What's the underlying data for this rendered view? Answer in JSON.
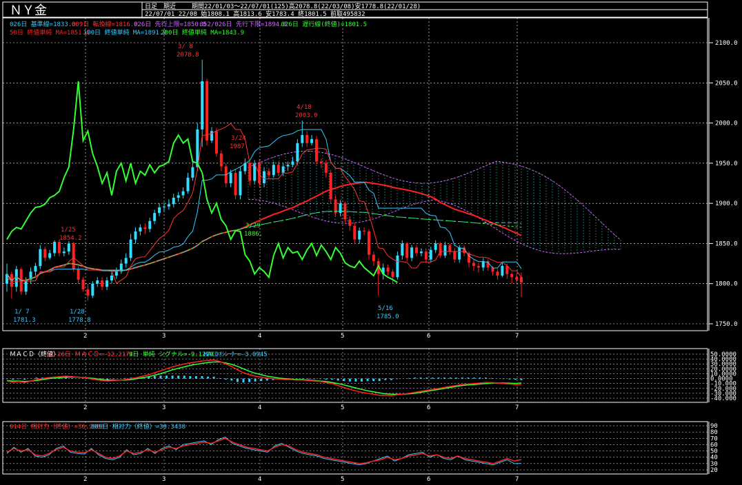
{
  "header": {
    "title": "ＮＹ金",
    "mode": "日足　期近",
    "line1": "期間22/01/03～22/07/01(125)高2078.8(22/03/08)安1778.8(22/01/28)",
    "line2": "22/07/01 22/08 始1808.1 高1813.6 安1783.4 終1801.5 前取495832"
  },
  "legend": {
    "row1": [
      {
        "text": "026日 基準線=1833.0",
        "color": "#33ccff"
      },
      {
        "text": "009日 転換線=1816.9",
        "color": "#ff3333"
      },
      {
        "text": "026日 先行上限=1850.0",
        "color": "#cc66ff"
      },
      {
        "text": "052/026日 先行下限=1894.0",
        "color": "#cc66ff"
      },
      {
        "text": "026日 遅行線(終値)=1801.5",
        "color": "#33ff33"
      }
    ],
    "row2": [
      {
        "text": "50日 終値単純 MA=1851.4",
        "color": "#ff2222"
      },
      {
        "text": "100日 終値単純 MA=1891.2",
        "color": "#33ccff"
      },
      {
        "text": "200日 終値単純 MA=1843.9",
        "color": "#33ff33"
      }
    ]
  },
  "macd_legend": [
    {
      "text": "ＭＡＣＤ（終値）",
      "color": "#ffffff"
    },
    {
      "text": "12-26日 ＭＡＣＤ=-12.2174",
      "color": "#ff3333"
    },
    {
      "text": "9日 単純 シグナル=-9.1229",
      "color": "#33ff33"
    },
    {
      "text": "MACDｵｼﾚｰﾀｰ=-3.0945",
      "color": "#33ccff"
    }
  ],
  "rsi_legend": [
    {
      "text": "014日 相対力（終値）=36.2803",
      "color": "#ff3333"
    },
    {
      "text": "009日 相対力（終値）=30.3438",
      "color": "#33ccff"
    }
  ],
  "annotations": [
    {
      "label": "3/ 8",
      "value": "2078.8",
      "color": "#ff3333"
    },
    {
      "label": "4/18",
      "value": "2003.0",
      "color": "#ff3333"
    },
    {
      "label": "3/24",
      "value": "1987.",
      "color": "#ff3333"
    },
    {
      "label": "1/25",
      "value": "1854.2",
      "color": "#ff3333"
    },
    {
      "label": "3/29",
      "value": "1886.",
      "color": "#33ff33"
    },
    {
      "label": "1/ 7",
      "value": "1781.3",
      "color": "#33ccff"
    },
    {
      "label": "1/28",
      "value": "1778.8",
      "color": "#33ccff"
    },
    {
      "label": "5/16",
      "value": "1785.0",
      "color": "#33ccff"
    }
  ],
  "chart_data": [
    {
      "type": "candlestick",
      "name": "price",
      "x_ticks": [
        "2",
        "3",
        "4",
        "5",
        "6",
        "7"
      ],
      "y_ticks": [
        1750,
        1800,
        1850,
        1900,
        1950,
        2000,
        2050,
        2100
      ],
      "y_tick_labels": [
        "1750.0",
        "1800.0",
        "1850.0",
        "1900.0",
        "1950.0",
        "2000.0",
        "2050.0",
        "2100.0"
      ],
      "ylim": [
        1740,
        2115
      ],
      "closes": [
        1812,
        1796,
        1818,
        1790,
        1805,
        1815,
        1822,
        1843,
        1832,
        1838,
        1852,
        1838,
        1840,
        1850,
        1818,
        1805,
        1793,
        1785,
        1800,
        1804,
        1796,
        1804,
        1810,
        1815,
        1825,
        1832,
        1855,
        1865,
        1870,
        1868,
        1878,
        1888,
        1895,
        1896,
        1899,
        1907,
        1910,
        1915,
        1932,
        1945,
        1992,
        2052,
        1978,
        1990,
        1962,
        1946,
        1925,
        1938,
        1910,
        1940,
        1950,
        1928,
        1950,
        1925,
        1940,
        1935,
        1948,
        1938,
        1946,
        1948,
        1952,
        1975,
        1985,
        1975,
        1980,
        1952,
        1950,
        1938,
        1905,
        1888,
        1900,
        1880,
        1872,
        1855,
        1866,
        1865,
        1836,
        1828,
        1812,
        1820,
        1815,
        1808,
        1835,
        1850,
        1832,
        1845,
        1838,
        1840,
        1830,
        1842,
        1850,
        1835,
        1848,
        1840,
        1830,
        1845,
        1838,
        1826,
        1822,
        1820,
        1828,
        1820,
        1815,
        1810,
        1822,
        1812,
        1808,
        1805,
        1801.5
      ],
      "opens": [
        1800,
        1812,
        1796,
        1818,
        1790,
        1805,
        1815,
        1822,
        1843,
        1832,
        1838,
        1852,
        1838,
        1840,
        1850,
        1818,
        1805,
        1793,
        1785,
        1800,
        1804,
        1796,
        1804,
        1810,
        1815,
        1825,
        1832,
        1855,
        1865,
        1870,
        1868,
        1878,
        1888,
        1895,
        1896,
        1899,
        1907,
        1910,
        1915,
        1932,
        1945,
        1992,
        2052,
        1978,
        1990,
        1962,
        1946,
        1925,
        1938,
        1910,
        1940,
        1950,
        1928,
        1950,
        1925,
        1940,
        1935,
        1948,
        1938,
        1946,
        1948,
        1952,
        1975,
        1985,
        1975,
        1980,
        1952,
        1950,
        1938,
        1905,
        1888,
        1900,
        1880,
        1872,
        1855,
        1866,
        1865,
        1836,
        1828,
        1812,
        1820,
        1815,
        1808,
        1835,
        1850,
        1832,
        1845,
        1838,
        1840,
        1830,
        1842,
        1850,
        1835,
        1848,
        1840,
        1830,
        1845,
        1838,
        1826,
        1822,
        1820,
        1828,
        1820,
        1815,
        1810,
        1822,
        1812,
        1808,
        1808.1
      ],
      "highs": [
        1825,
        1815,
        1822,
        1820,
        1808,
        1820,
        1826,
        1848,
        1846,
        1842,
        1854,
        1855,
        1845,
        1853,
        1852,
        1822,
        1808,
        1800,
        1803,
        1808,
        1808,
        1808,
        1814,
        1820,
        1830,
        1838,
        1862,
        1870,
        1874,
        1875,
        1882,
        1892,
        1900,
        1901,
        1905,
        1912,
        1914,
        1920,
        1938,
        1952,
        2000,
        2078.8,
        2055,
        1995,
        1994,
        1966,
        1950,
        1942,
        1942,
        1946,
        1956,
        1952,
        1954,
        1955,
        1945,
        1944,
        1952,
        1952,
        1950,
        1952,
        1958,
        1980,
        2003,
        1990,
        1985,
        1984,
        1956,
        1954,
        1942,
        1910,
        1904,
        1902,
        1884,
        1876,
        1870,
        1870,
        1868,
        1840,
        1832,
        1825,
        1824,
        1818,
        1840,
        1854,
        1852,
        1848,
        1848,
        1844,
        1844,
        1846,
        1854,
        1852,
        1852,
        1850,
        1844,
        1848,
        1848,
        1840,
        1830,
        1826,
        1832,
        1830,
        1822,
        1818,
        1826,
        1825,
        1814,
        1812,
        1813.6
      ],
      "lows": [
        1790,
        1781.3,
        1790,
        1786,
        1786,
        1800,
        1810,
        1818,
        1828,
        1830,
        1834,
        1834,
        1834,
        1836,
        1815,
        1800,
        1790,
        1778.8,
        1782,
        1796,
        1792,
        1792,
        1800,
        1806,
        1812,
        1820,
        1828,
        1850,
        1860,
        1862,
        1864,
        1874,
        1884,
        1890,
        1892,
        1895,
        1902,
        1906,
        1912,
        1928,
        1940,
        1970,
        1972,
        1975,
        1958,
        1940,
        1920,
        1920,
        1905,
        1905,
        1936,
        1922,
        1924,
        1920,
        1920,
        1930,
        1932,
        1934,
        1934,
        1940,
        1945,
        1948,
        1970,
        1970,
        1972,
        1948,
        1944,
        1932,
        1900,
        1884,
        1884,
        1876,
        1866,
        1850,
        1850,
        1860,
        1830,
        1822,
        1785,
        1805,
        1810,
        1800,
        1805,
        1830,
        1828,
        1828,
        1834,
        1834,
        1826,
        1826,
        1838,
        1832,
        1832,
        1836,
        1826,
        1826,
        1834,
        1820,
        1816,
        1814,
        1816,
        1816,
        1810,
        1805,
        1808,
        1806,
        1800,
        1800,
        1783.4
      ]
    },
    {
      "type": "line",
      "name": "MACD",
      "y_tick_labels": [
        "50.0000",
        "40.0000",
        "30.0000",
        "20.0000",
        "10.0000",
        "0.0000",
        "-10.000",
        "-20.000",
        "-30.000",
        "-40.000"
      ],
      "ylim": [
        -45,
        55
      ],
      "series": [
        {
          "name": "MACD",
          "values": [
            -5,
            -7,
            -6,
            -8,
            -5,
            -2,
            0,
            2,
            3,
            4,
            5,
            4,
            3,
            2,
            0,
            -2,
            -4,
            -5,
            -4,
            -3,
            -2,
            0,
            2,
            5,
            8,
            12,
            16,
            20,
            24,
            27,
            30,
            32,
            34,
            36,
            37,
            38,
            35,
            30,
            25,
            18,
            12,
            8,
            5,
            3,
            1,
            0,
            -1,
            -2,
            -2,
            -3,
            -3,
            -4,
            -5,
            -6,
            -8,
            -10,
            -14,
            -18,
            -22,
            -25,
            -28,
            -30,
            -32,
            -34,
            -34,
            -35,
            -33,
            -32,
            -30,
            -28,
            -26,
            -24,
            -22,
            -20,
            -18,
            -16,
            -14,
            -12,
            -11,
            -10,
            -9,
            -8,
            -8,
            -9,
            -10,
            -11,
            -12,
            -12.2174
          ]
        },
        {
          "name": "シグナル",
          "values": [
            -4,
            -5,
            -5,
            -6,
            -5,
            -4,
            -2,
            0,
            1,
            2,
            3,
            3,
            3,
            2,
            1,
            0,
            -2,
            -3,
            -3,
            -3,
            -3,
            -2,
            0,
            2,
            4,
            7,
            10,
            14,
            18,
            21,
            24,
            27,
            29,
            31,
            33,
            34,
            34,
            32,
            29,
            25,
            20,
            15,
            11,
            8,
            5,
            3,
            1,
            0,
            -1,
            -2,
            -2,
            -3,
            -4,
            -5,
            -6,
            -8,
            -10,
            -13,
            -16,
            -19,
            -22,
            -25,
            -27,
            -29,
            -31,
            -32,
            -32,
            -32,
            -31,
            -30,
            -28,
            -26,
            -24,
            -22,
            -20,
            -18,
            -16,
            -14,
            -13,
            -12,
            -11,
            -10,
            -9,
            -9,
            -9,
            -9.5,
            -9.8,
            -9.1229
          ]
        }
      ]
    },
    {
      "type": "line",
      "name": "RSI",
      "y_tick_labels": [
        "90",
        "80",
        "70",
        "60",
        "50",
        "40",
        "30",
        "20"
      ],
      "ylim": [
        15,
        92
      ],
      "series": [
        {
          "name": "014日 相対力",
          "values": [
            48,
            54,
            50,
            52,
            44,
            42,
            46,
            52,
            56,
            50,
            48,
            47,
            52,
            46,
            40,
            38,
            42,
            50,
            46,
            48,
            52,
            48,
            52,
            56,
            54,
            58,
            60,
            62,
            64,
            62,
            66,
            70,
            64,
            60,
            56,
            54,
            52,
            50,
            56,
            60,
            58,
            52,
            48,
            46,
            44,
            40,
            38,
            36,
            34,
            32,
            30,
            31,
            34,
            36,
            40,
            36,
            38,
            42,
            44,
            46,
            42,
            44,
            40,
            38,
            42,
            38,
            36,
            34,
            32,
            30,
            34,
            38,
            34,
            36.2803
          ]
        },
        {
          "name": "009日 相対力",
          "values": [
            46,
            56,
            48,
            54,
            42,
            40,
            44,
            54,
            58,
            48,
            46,
            45,
            54,
            44,
            38,
            36,
            40,
            52,
            44,
            46,
            54,
            46,
            54,
            58,
            52,
            60,
            62,
            64,
            66,
            60,
            68,
            72,
            62,
            58,
            54,
            52,
            50,
            48,
            58,
            62,
            56,
            50,
            46,
            44,
            42,
            38,
            36,
            34,
            32,
            30,
            28,
            30,
            34,
            38,
            42,
            34,
            38,
            44,
            46,
            48,
            40,
            44,
            38,
            36,
            42,
            36,
            34,
            32,
            30,
            28,
            32,
            36,
            30,
            30.3438
          ]
        }
      ]
    }
  ]
}
